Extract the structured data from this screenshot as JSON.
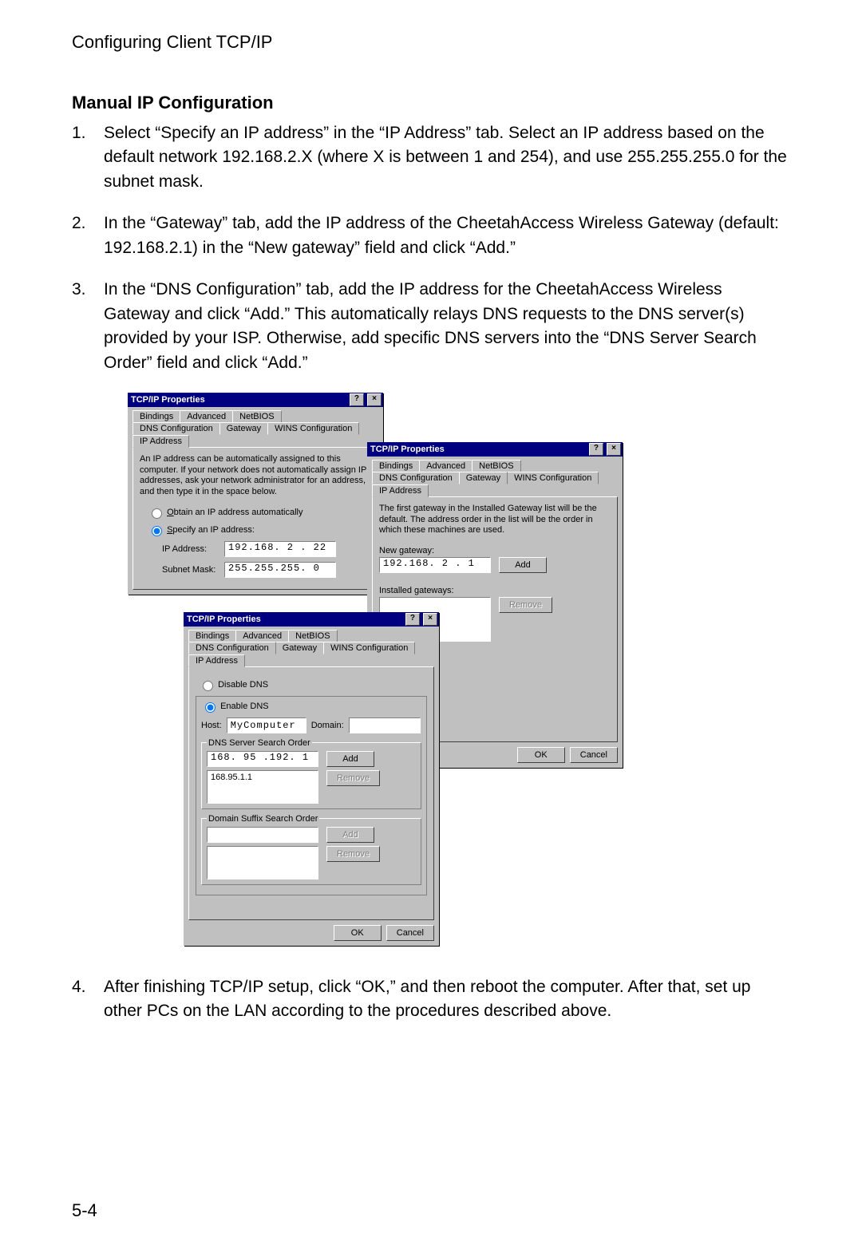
{
  "header": "Configuring Client TCP/IP",
  "section_title": "Manual IP Configuration",
  "steps": [
    "Select “Specify an IP address” in the “IP Address” tab. Select an IP address based on the default network 192.168.2.X (where X is between 1 and 254), and use 255.255.255.0 for the subnet mask.",
    "In the “Gateway” tab, add the IP address of the CheetahAccess Wireless Gateway (default: 192.168.2.1) in the “New gateway” field and click “Add.”",
    "In the “DNS Configuration” tab, add the IP address for the CheetahAccess Wireless Gateway and click “Add.” This automatically relays DNS requests to the DNS server(s) provided by your ISP. Otherwise, add specific DNS servers into the “DNS Server Search Order” field and click “Add.”",
    "After finishing TCP/IP setup, click “OK,” and then reboot the computer. After that, set up other PCs on the LAN according to the procedures described above."
  ],
  "dialogs": {
    "common": {
      "title": "TCP/IP Properties",
      "tabs_row1": [
        "Bindings",
        "Advanced",
        "NetBIOS"
      ],
      "tabs_row2": [
        "DNS Configuration",
        "Gateway",
        "WINS Configuration",
        "IP Address"
      ],
      "ok": "OK",
      "cancel": "Cancel"
    },
    "ip": {
      "note": "An IP address can be automatically assigned to this computer. If your network does not automatically assign IP addresses, ask your network administrator for an address, and then type it in the space below.",
      "radio_obtain": "Obtain an IP address automatically",
      "radio_specify": "Specify an IP address:",
      "ip_label": "IP Address:",
      "ip_value": "192.168. 2 . 22",
      "mask_label": "Subnet Mask:",
      "mask_value": "255.255.255. 0"
    },
    "gateway": {
      "note": "The first gateway in the Installed Gateway list will be the default. The address order in the list will be the order in which these machines are used.",
      "new_label": "New gateway:",
      "new_value": "192.168. 2 . 1",
      "add": "Add",
      "installed_label": "Installed gateways:",
      "remove": "Remove"
    },
    "dns": {
      "radio_disable": "Disable DNS",
      "radio_enable": "Enable DNS",
      "host_label": "Host:",
      "host_value": "MyComputer",
      "domain_label": "Domain:",
      "domain_value": "",
      "search_label": "DNS Server Search Order",
      "search_input": "168. 95 .192. 1",
      "search_list": "168.95.1.1",
      "suffix_label": "Domain Suffix Search Order",
      "add": "Add",
      "remove": "Remove"
    }
  },
  "page_number": "5-4"
}
